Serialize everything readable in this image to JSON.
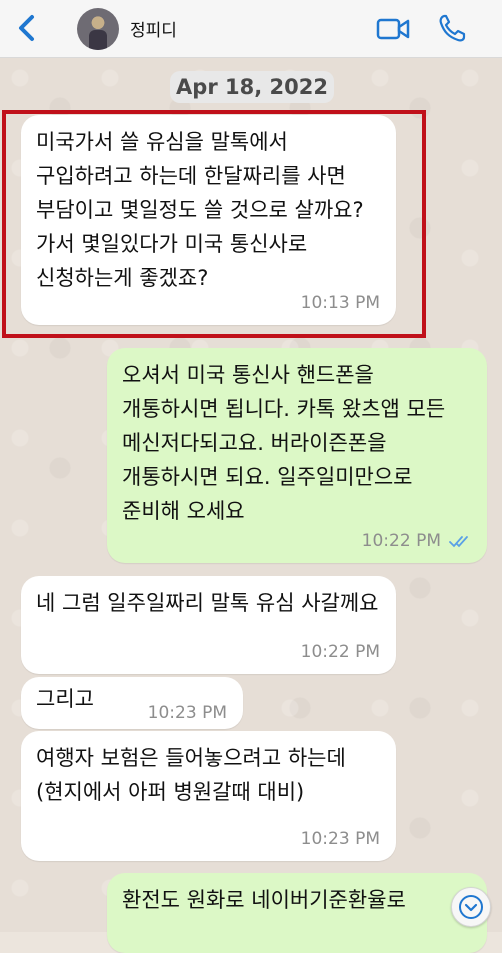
{
  "header": {
    "contact_name": "정피디",
    "back_icon": "chevron-left-icon",
    "video_icon": "video-camera-icon",
    "call_icon": "phone-icon",
    "accent_color": "#1f77d0"
  },
  "date_separator": "Apr 18, 2022",
  "messages": [
    {
      "direction": "incoming",
      "text": "미국가서 쓸 유심을 말톡에서 구입하려고 하는데 한달짜리를 사면 부담이고 몇일정도 쓸 것으로 살까요? 가서 몇일있다가 미국 통신사로 신청하는게 좋겠죠?",
      "time": "10:13 PM",
      "highlighted": true
    },
    {
      "direction": "outgoing",
      "text": "오셔서 미국 통신사 핸드폰을 개통하시면 됩니다. 카톡 왔츠앱 모든 메신저다되고요. 버라이즌폰을 개통하시면 되요. 일주일미만으로 준비해 오세요",
      "time": "10:22 PM",
      "status": "read"
    },
    {
      "direction": "incoming",
      "text": "네 그럼 일주일짜리 말톡 유심 사갈께요",
      "time": "10:22 PM"
    },
    {
      "direction": "incoming",
      "text": "그리고",
      "time": "10:23 PM"
    },
    {
      "direction": "incoming",
      "text": "여행자 보험은 들어놓으려고 하는데(현지에서 아퍼 병원갈때 대비)",
      "time": "10:23 PM"
    },
    {
      "direction": "outgoing",
      "text": "환전도 원화로 네이버기준환율로",
      "time": ""
    }
  ],
  "colors": {
    "incoming_bubble": "#ffffff",
    "outgoing_bubble": "#dcf8c6",
    "highlight_border": "#c0101a",
    "read_ticks": "#5aa0e6"
  },
  "scroll_down_icon": "chevron-down-circle-icon"
}
